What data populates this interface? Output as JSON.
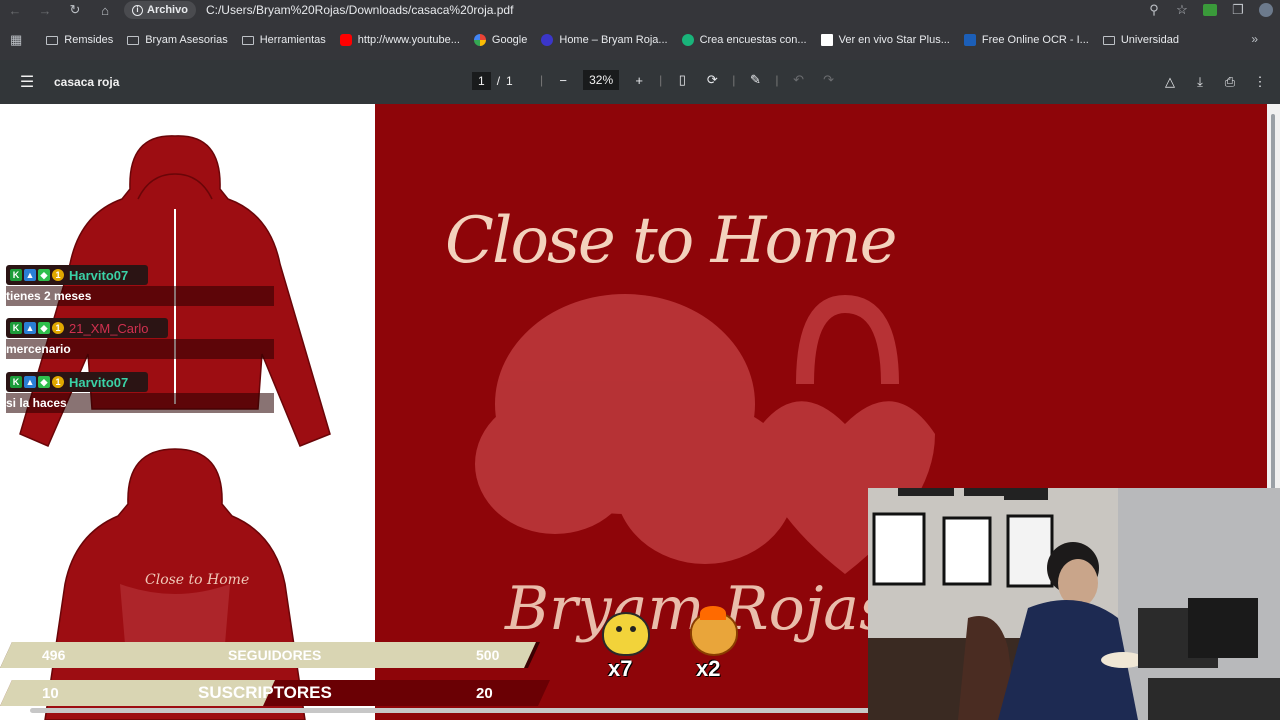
{
  "browser": {
    "site_chip": "Archivo",
    "url": "C:/Users/Bryam%20Rojas/Downloads/casaca%20roja.pdf"
  },
  "bookmarks": [
    {
      "label": "Remsides",
      "icon": "folder-icon"
    },
    {
      "label": "Bryam Asesorias",
      "icon": "folder-icon"
    },
    {
      "label": "Herramientas",
      "icon": "folder-icon"
    },
    {
      "label": "http://www.youtube...",
      "icon": "youtube-icon"
    },
    {
      "label": "Google",
      "icon": "google-icon"
    },
    {
      "label": "Home – Bryam Roja...",
      "icon": "site-icon"
    },
    {
      "label": "Crea encuestas con...",
      "icon": "survey-icon"
    },
    {
      "label": "Ver en vivo Star Plus...",
      "icon": "page-icon"
    },
    {
      "label": "Free Online OCR - I...",
      "icon": "ocr-icon"
    },
    {
      "label": "Universidad",
      "icon": "folder-icon"
    }
  ],
  "pdf": {
    "title": "casaca roja",
    "page_current": "1",
    "page_sep": "/",
    "page_total": "1",
    "zoom": "32%"
  },
  "design": {
    "script_title": "Close to Home",
    "script_bottom": "Bryam Rojas"
  },
  "chat": [
    {
      "user": "Harvito07",
      "user_color": "#3ad1a6",
      "text": "tienes 2 meses"
    },
    {
      "user": "21_XM_Carlo",
      "user_color": "#d1304f",
      "text": "mercenario"
    },
    {
      "user": "Harvito07",
      "user_color": "#3ad1a6",
      "text": "si la haces"
    }
  ],
  "stats": {
    "followers": {
      "current": "496",
      "label": "SEGUIDORES",
      "goal": "500",
      "progress": 0.992
    },
    "subscribers": {
      "current": "10",
      "label": "SUSCRIPTORES",
      "goal": "20",
      "progress": 0.5
    }
  },
  "emotes": [
    {
      "name": "duck-emote",
      "count": "x7"
    },
    {
      "name": "fire-dog-emote",
      "count": "x2"
    }
  ],
  "colors": {
    "page_red": "#8e0509",
    "pdf_toolbar": "#323639",
    "browser_chrome": "#35363a"
  }
}
